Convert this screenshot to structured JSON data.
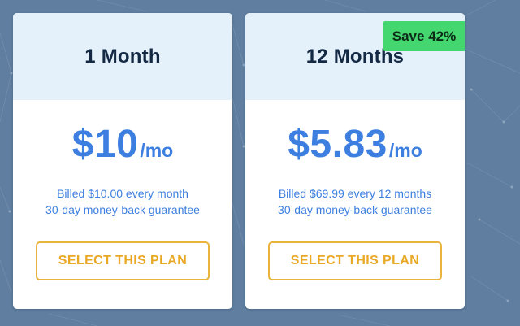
{
  "plans": [
    {
      "title": "1 Month",
      "price": "$10",
      "unit": "/mo",
      "billing_line_1": "Billed $10.00 every month",
      "billing_line_2": "30-day money-back guarantee",
      "cta_label": "SELECT THIS PLAN"
    },
    {
      "title": "12 Months",
      "badge": "Save 42%",
      "price": "$5.83",
      "unit": "/mo",
      "billing_line_1": "Billed $69.99 every 12 months",
      "billing_line_2": "30-day money-back guarantee",
      "cta_label": "SELECT THIS PLAN"
    }
  ],
  "colors": {
    "background": "#5f7ea0",
    "card_header": "#e5f1fa",
    "price_blue": "#3d7fe0",
    "cta_orange": "#e9a825",
    "badge_green": "#44d76f",
    "title_navy": "#142a44"
  }
}
